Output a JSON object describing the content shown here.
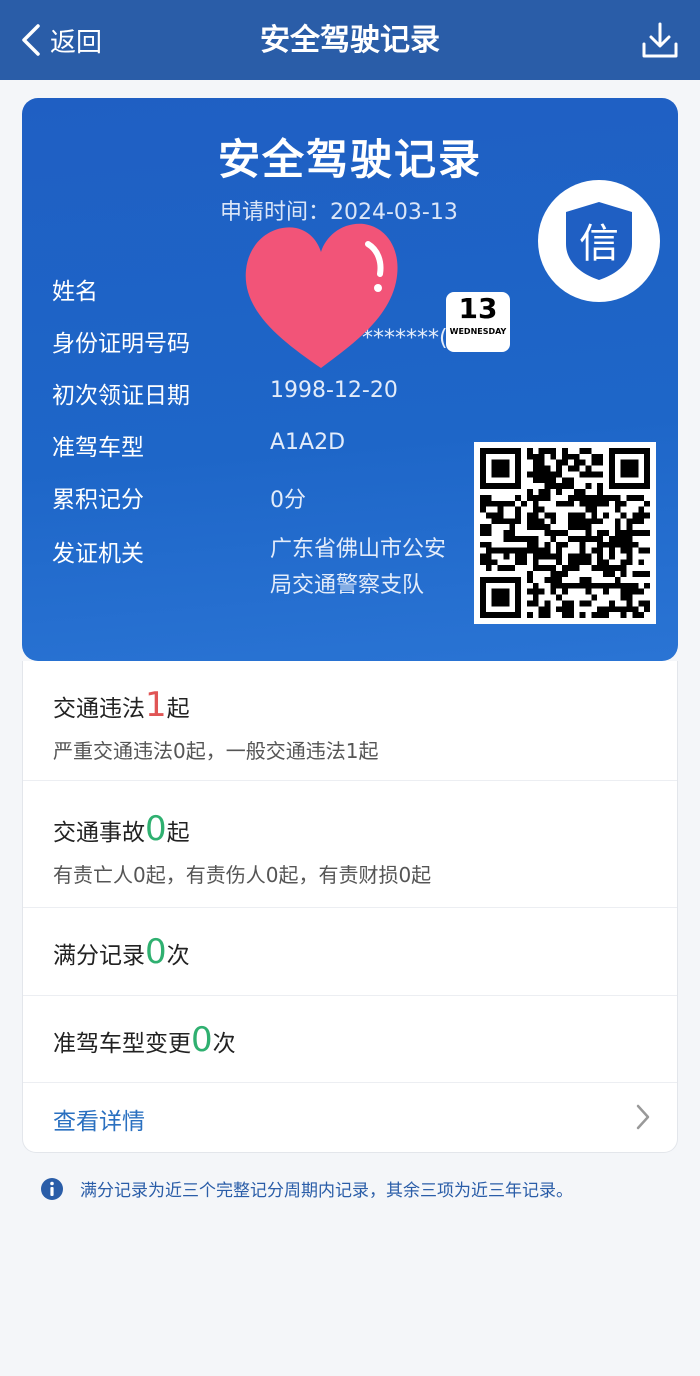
{
  "nav": {
    "back_label": "返回",
    "title": "安全驾驶记录"
  },
  "card": {
    "title": "安全驾驶记录",
    "apply_time": "申请时间：2024-03-13",
    "fields": [
      {
        "label": "姓名",
        "value": ""
      },
      {
        "label": "身份证明号码",
        "value": "*******("
      },
      {
        "label": "初次领证日期",
        "value": "1998-12-20"
      },
      {
        "label": "准驾车型",
        "value": "A1A2D"
      },
      {
        "label": "累积记分",
        "value": "0分"
      },
      {
        "label": "发证机关",
        "value": "广东省佛山市公安局交通警察支队"
      }
    ],
    "badge_char": "信",
    "sticker": {
      "day_num": "13",
      "weekday": "WEDNESDAY"
    }
  },
  "records": {
    "violation": {
      "prefix": "交通违法",
      "count": "1",
      "suffix": "起",
      "detail": "严重交通违法0起，一般交通违法1起"
    },
    "accident": {
      "prefix": "交通事故",
      "count": "0",
      "suffix": "起",
      "detail": "有责亡人0起，有责伤人0起，有责财损0起"
    },
    "full_score": {
      "prefix": "满分记录",
      "count": "0",
      "suffix": "次"
    },
    "class_change": {
      "prefix": "准驾车型变更",
      "count": "0",
      "suffix": "次"
    },
    "detail_link": "查看详情"
  },
  "footnote": "满分记录为近三个完整记分周期内记录，其余三项为近三年记录。",
  "colors": {
    "nav_bg": "#2a5da8",
    "card_bg": "#1f5fc3",
    "count_red": "#e05555",
    "count_green": "#2fb070",
    "link": "#2a70c0"
  }
}
